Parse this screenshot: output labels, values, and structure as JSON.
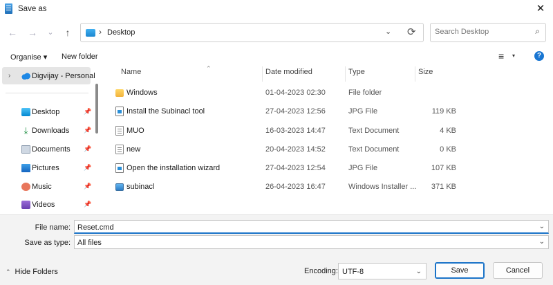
{
  "window": {
    "title": "Save as",
    "close_glyph": "✕"
  },
  "nav": {
    "back_glyph": "←",
    "forward_glyph": "→",
    "recent_glyph": "⌄",
    "up_glyph": "↑",
    "path_sep": "›",
    "current_folder": "Desktop",
    "address_dropdown_glyph": "⌄",
    "refresh_glyph": "⟳"
  },
  "search": {
    "placeholder": "Search Desktop",
    "icon": "⌕"
  },
  "toolbar": {
    "organise_label": "Organise ▾",
    "new_folder_label": "New folder",
    "view_glyph": "≡",
    "view_dd_glyph": "▾",
    "help_glyph": "?"
  },
  "sidebar": {
    "top": {
      "chevron": "›",
      "label": "Digvijay - Personal"
    },
    "items": [
      {
        "label": "Desktop",
        "icon": "desktop-icon",
        "pin": "📌"
      },
      {
        "label": "Downloads",
        "icon": "downloads-icon",
        "glyph": "⤓",
        "pin": "📌"
      },
      {
        "label": "Documents",
        "icon": "documents-icon",
        "pin": "📌"
      },
      {
        "label": "Pictures",
        "icon": "pictures-icon",
        "pin": "📌"
      },
      {
        "label": "Music",
        "icon": "music-icon",
        "pin": "📌"
      },
      {
        "label": "Videos",
        "icon": "videos-icon",
        "pin": "📌"
      }
    ]
  },
  "columns": {
    "name": "Name",
    "date": "Date modified",
    "type": "Type",
    "size": "Size",
    "sort_glyph": "⌃"
  },
  "files": [
    {
      "name": "Windows",
      "date": "01-04-2023 02:30",
      "type": "File folder",
      "size": "",
      "kind": "folder"
    },
    {
      "name": "Install the Subinacl tool",
      "date": "27-04-2023 12:56",
      "type": "JPG File",
      "size": "119 KB",
      "kind": "image"
    },
    {
      "name": "MUO",
      "date": "16-03-2023 14:47",
      "type": "Text Document",
      "size": "4 KB",
      "kind": "text"
    },
    {
      "name": "new",
      "date": "20-04-2023 14:52",
      "type": "Text Document",
      "size": "0 KB",
      "kind": "text"
    },
    {
      "name": "Open the installation wizard",
      "date": "27-04-2023 12:54",
      "type": "JPG File",
      "size": "107 KB",
      "kind": "image"
    },
    {
      "name": "subinacl",
      "date": "26-04-2023 16:47",
      "type": "Windows Installer ...",
      "size": "371 KB",
      "kind": "installer"
    }
  ],
  "form": {
    "file_name_label": "File name:",
    "file_name_value": "Reset.cmd",
    "save_as_type_label": "Save as type:",
    "save_as_type_value": "All files",
    "dropdown_glyph": "⌄"
  },
  "footer": {
    "hide_folders_label": "Hide Folders",
    "hide_folders_chevron": "⌃",
    "encoding_label": "Encoding:",
    "encoding_value": "UTF-8",
    "save_label": "Save",
    "cancel_label": "Cancel"
  },
  "colors": {
    "accent": "#1a73c8",
    "selected_bg": "#e5e5e5",
    "footer_bg": "#f3f3f3"
  }
}
